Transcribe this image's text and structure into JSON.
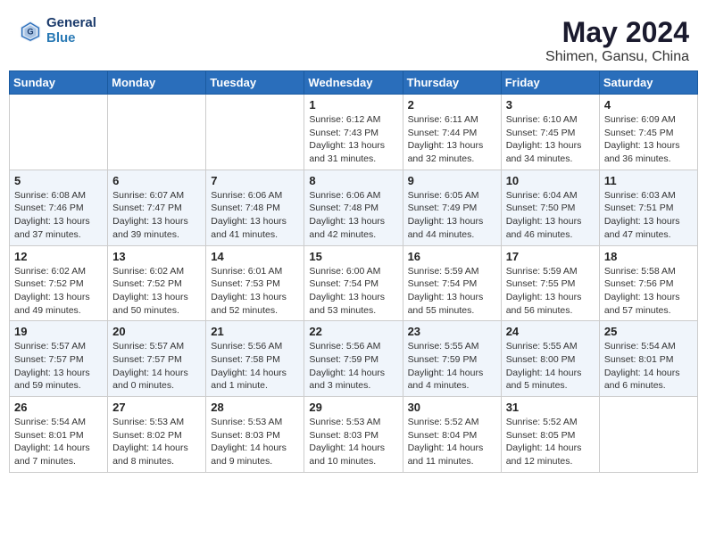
{
  "logo": {
    "line1": "General",
    "line2": "Blue"
  },
  "title": "May 2024",
  "location": "Shimen, Gansu, China",
  "days_of_week": [
    "Sunday",
    "Monday",
    "Tuesday",
    "Wednesday",
    "Thursday",
    "Friday",
    "Saturday"
  ],
  "weeks": [
    [
      {
        "day": "",
        "info": ""
      },
      {
        "day": "",
        "info": ""
      },
      {
        "day": "",
        "info": ""
      },
      {
        "day": "1",
        "info": "Sunrise: 6:12 AM\nSunset: 7:43 PM\nDaylight: 13 hours\nand 31 minutes."
      },
      {
        "day": "2",
        "info": "Sunrise: 6:11 AM\nSunset: 7:44 PM\nDaylight: 13 hours\nand 32 minutes."
      },
      {
        "day": "3",
        "info": "Sunrise: 6:10 AM\nSunset: 7:45 PM\nDaylight: 13 hours\nand 34 minutes."
      },
      {
        "day": "4",
        "info": "Sunrise: 6:09 AM\nSunset: 7:45 PM\nDaylight: 13 hours\nand 36 minutes."
      }
    ],
    [
      {
        "day": "5",
        "info": "Sunrise: 6:08 AM\nSunset: 7:46 PM\nDaylight: 13 hours\nand 37 minutes."
      },
      {
        "day": "6",
        "info": "Sunrise: 6:07 AM\nSunset: 7:47 PM\nDaylight: 13 hours\nand 39 minutes."
      },
      {
        "day": "7",
        "info": "Sunrise: 6:06 AM\nSunset: 7:48 PM\nDaylight: 13 hours\nand 41 minutes."
      },
      {
        "day": "8",
        "info": "Sunrise: 6:06 AM\nSunset: 7:48 PM\nDaylight: 13 hours\nand 42 minutes."
      },
      {
        "day": "9",
        "info": "Sunrise: 6:05 AM\nSunset: 7:49 PM\nDaylight: 13 hours\nand 44 minutes."
      },
      {
        "day": "10",
        "info": "Sunrise: 6:04 AM\nSunset: 7:50 PM\nDaylight: 13 hours\nand 46 minutes."
      },
      {
        "day": "11",
        "info": "Sunrise: 6:03 AM\nSunset: 7:51 PM\nDaylight: 13 hours\nand 47 minutes."
      }
    ],
    [
      {
        "day": "12",
        "info": "Sunrise: 6:02 AM\nSunset: 7:52 PM\nDaylight: 13 hours\nand 49 minutes."
      },
      {
        "day": "13",
        "info": "Sunrise: 6:02 AM\nSunset: 7:52 PM\nDaylight: 13 hours\nand 50 minutes."
      },
      {
        "day": "14",
        "info": "Sunrise: 6:01 AM\nSunset: 7:53 PM\nDaylight: 13 hours\nand 52 minutes."
      },
      {
        "day": "15",
        "info": "Sunrise: 6:00 AM\nSunset: 7:54 PM\nDaylight: 13 hours\nand 53 minutes."
      },
      {
        "day": "16",
        "info": "Sunrise: 5:59 AM\nSunset: 7:54 PM\nDaylight: 13 hours\nand 55 minutes."
      },
      {
        "day": "17",
        "info": "Sunrise: 5:59 AM\nSunset: 7:55 PM\nDaylight: 13 hours\nand 56 minutes."
      },
      {
        "day": "18",
        "info": "Sunrise: 5:58 AM\nSunset: 7:56 PM\nDaylight: 13 hours\nand 57 minutes."
      }
    ],
    [
      {
        "day": "19",
        "info": "Sunrise: 5:57 AM\nSunset: 7:57 PM\nDaylight: 13 hours\nand 59 minutes."
      },
      {
        "day": "20",
        "info": "Sunrise: 5:57 AM\nSunset: 7:57 PM\nDaylight: 14 hours\nand 0 minutes."
      },
      {
        "day": "21",
        "info": "Sunrise: 5:56 AM\nSunset: 7:58 PM\nDaylight: 14 hours\nand 1 minute."
      },
      {
        "day": "22",
        "info": "Sunrise: 5:56 AM\nSunset: 7:59 PM\nDaylight: 14 hours\nand 3 minutes."
      },
      {
        "day": "23",
        "info": "Sunrise: 5:55 AM\nSunset: 7:59 PM\nDaylight: 14 hours\nand 4 minutes."
      },
      {
        "day": "24",
        "info": "Sunrise: 5:55 AM\nSunset: 8:00 PM\nDaylight: 14 hours\nand 5 minutes."
      },
      {
        "day": "25",
        "info": "Sunrise: 5:54 AM\nSunset: 8:01 PM\nDaylight: 14 hours\nand 6 minutes."
      }
    ],
    [
      {
        "day": "26",
        "info": "Sunrise: 5:54 AM\nSunset: 8:01 PM\nDaylight: 14 hours\nand 7 minutes."
      },
      {
        "day": "27",
        "info": "Sunrise: 5:53 AM\nSunset: 8:02 PM\nDaylight: 14 hours\nand 8 minutes."
      },
      {
        "day": "28",
        "info": "Sunrise: 5:53 AM\nSunset: 8:03 PM\nDaylight: 14 hours\nand 9 minutes."
      },
      {
        "day": "29",
        "info": "Sunrise: 5:53 AM\nSunset: 8:03 PM\nDaylight: 14 hours\nand 10 minutes."
      },
      {
        "day": "30",
        "info": "Sunrise: 5:52 AM\nSunset: 8:04 PM\nDaylight: 14 hours\nand 11 minutes."
      },
      {
        "day": "31",
        "info": "Sunrise: 5:52 AM\nSunset: 8:05 PM\nDaylight: 14 hours\nand 12 minutes."
      },
      {
        "day": "",
        "info": ""
      }
    ]
  ]
}
